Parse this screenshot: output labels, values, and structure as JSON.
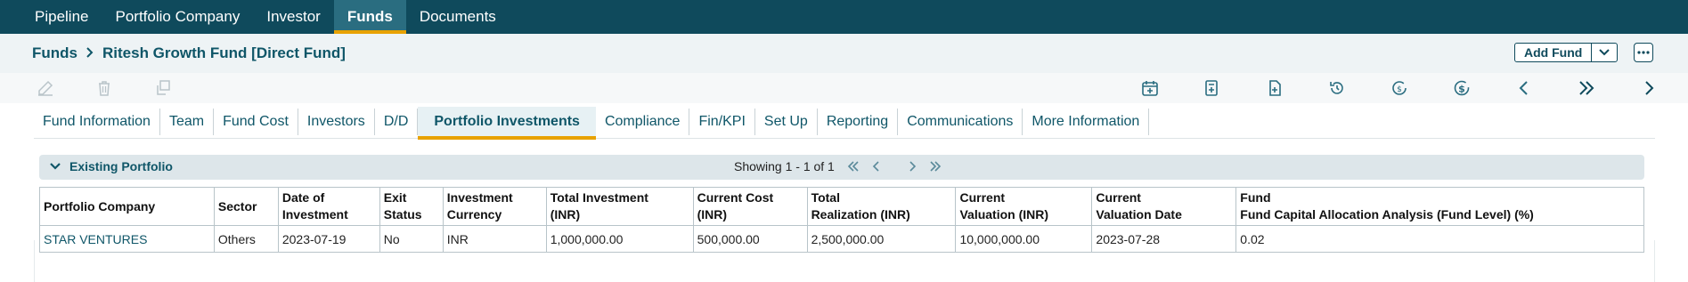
{
  "topnav": {
    "items": [
      {
        "label": "Pipeline",
        "active": false
      },
      {
        "label": "Portfolio Company",
        "active": false
      },
      {
        "label": "Investor",
        "active": false
      },
      {
        "label": "Funds",
        "active": true
      },
      {
        "label": "Documents",
        "active": false
      }
    ]
  },
  "breadcrumb": {
    "root": "Funds",
    "current": "Ritesh Growth Fund [Direct Fund]"
  },
  "header": {
    "add_fund_label": "Add Fund"
  },
  "toolbar": {
    "left_icons": [
      "edit-icon",
      "delete-icon",
      "copy-icon"
    ],
    "right_icons": [
      "calendar-add-icon",
      "calculator-icon",
      "file-add-icon",
      "history-icon",
      "currency-cycle-icon",
      "dollar-cycle-icon",
      "prev-icon",
      "last-icon",
      "next-icon"
    ]
  },
  "tabs": [
    {
      "label": "Fund Information",
      "active": false
    },
    {
      "label": "Team",
      "active": false
    },
    {
      "label": "Fund Cost",
      "active": false
    },
    {
      "label": "Investors",
      "active": false
    },
    {
      "label": "D/D",
      "active": false
    },
    {
      "label": "Portfolio Investments",
      "active": true
    },
    {
      "label": "Compliance",
      "active": false
    },
    {
      "label": "Fin/KPI",
      "active": false
    },
    {
      "label": "Set Up",
      "active": false
    },
    {
      "label": "Reporting",
      "active": false
    },
    {
      "label": "Communications",
      "active": false
    },
    {
      "label": "More Information",
      "active": false
    }
  ],
  "portfolio": {
    "title": "Existing Portfolio",
    "showing": "Showing 1 - 1 of 1",
    "columns": [
      [
        "Portfolio Company"
      ],
      [
        "Sector"
      ],
      [
        "Date of",
        "Investment"
      ],
      [
        "Exit",
        "Status"
      ],
      [
        "Investment",
        "Currency"
      ],
      [
        "Total Investment",
        "(INR)"
      ],
      [
        "Current Cost",
        "(INR)"
      ],
      [
        "Total",
        "Realization (INR)"
      ],
      [
        "Current",
        "Valuation (INR)"
      ],
      [
        "Current",
        "Valuation Date"
      ],
      [
        "Fund",
        "Fund Capital Allocation Analysis (Fund Level) (%)"
      ]
    ],
    "rows": [
      [
        "STAR VENTURES",
        "Others",
        "2023-07-19",
        "No",
        "INR",
        "1,000,000.00",
        "500,000.00",
        "2,500,000.00",
        "10,000,000.00",
        "2023-07-28",
        "0.02"
      ]
    ]
  },
  "colors": {
    "nav_bg": "#0f4a5c",
    "accent": "#e8a200",
    "link": "#0f5668"
  }
}
